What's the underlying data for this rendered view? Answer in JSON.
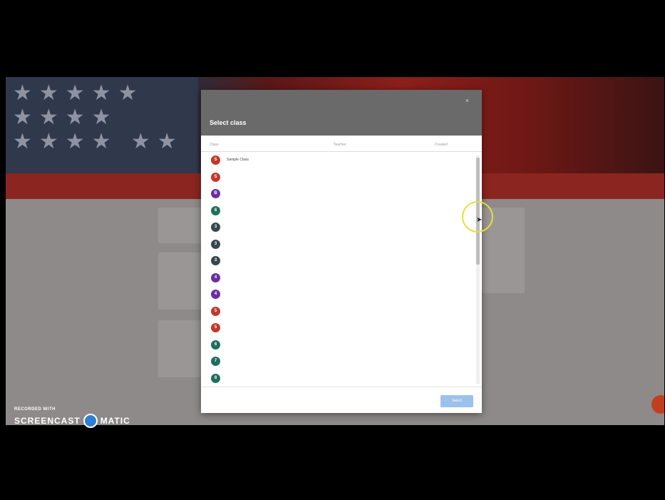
{
  "dialog": {
    "title": "Select class",
    "close_glyph": "×",
    "columns": {
      "class": "Class",
      "teacher": "Teacher",
      "created": "Created"
    },
    "select_label": "Select"
  },
  "rows": [
    {
      "initial": "S",
      "color": "#c0392b",
      "name": "Sample Class",
      "sub": "",
      "teacher": "",
      "created": ""
    },
    {
      "initial": "S",
      "color": "#c0392b",
      "name": "",
      "sub": "",
      "teacher": "",
      "created": ""
    },
    {
      "initial": "B",
      "color": "#6a2fa0",
      "name": "",
      "sub": "",
      "teacher": "",
      "created": ""
    },
    {
      "initial": "6",
      "color": "#1f6f5c",
      "name": "",
      "sub": "",
      "teacher": "",
      "created": ""
    },
    {
      "initial": "3",
      "color": "#37474f",
      "name": "",
      "sub": "",
      "teacher": "",
      "created": ""
    },
    {
      "initial": "3",
      "color": "#37474f",
      "name": "",
      "sub": "",
      "teacher": "",
      "created": ""
    },
    {
      "initial": "3",
      "color": "#37474f",
      "name": "",
      "sub": "",
      "teacher": "",
      "created": ""
    },
    {
      "initial": "4",
      "color": "#6a2fa0",
      "name": "",
      "sub": "",
      "teacher": "",
      "created": ""
    },
    {
      "initial": "4",
      "color": "#6a2fa0",
      "name": "",
      "sub": "",
      "teacher": "",
      "created": ""
    },
    {
      "initial": "5",
      "color": "#c0392b",
      "name": "",
      "sub": "",
      "teacher": "",
      "created": ""
    },
    {
      "initial": "5",
      "color": "#c0392b",
      "name": "",
      "sub": "",
      "teacher": "",
      "created": ""
    },
    {
      "initial": "6",
      "color": "#1f6f5c",
      "name": "",
      "sub": "",
      "teacher": "",
      "created": ""
    },
    {
      "initial": "7",
      "color": "#1f6f5c",
      "name": "",
      "sub": "",
      "teacher": "",
      "created": ""
    },
    {
      "initial": "8",
      "color": "#1f6f5c",
      "name": "",
      "sub": "",
      "teacher": "",
      "created": ""
    }
  ],
  "watermark": {
    "line1": "RECORDED WITH",
    "left": "SCREENCAST",
    "right": "MATIC"
  },
  "colors": {
    "header": "#6a6a6a",
    "red_bar": "#8b2520",
    "select_button": "#9cc1ea",
    "cursor_ring": "#e6e03a"
  }
}
